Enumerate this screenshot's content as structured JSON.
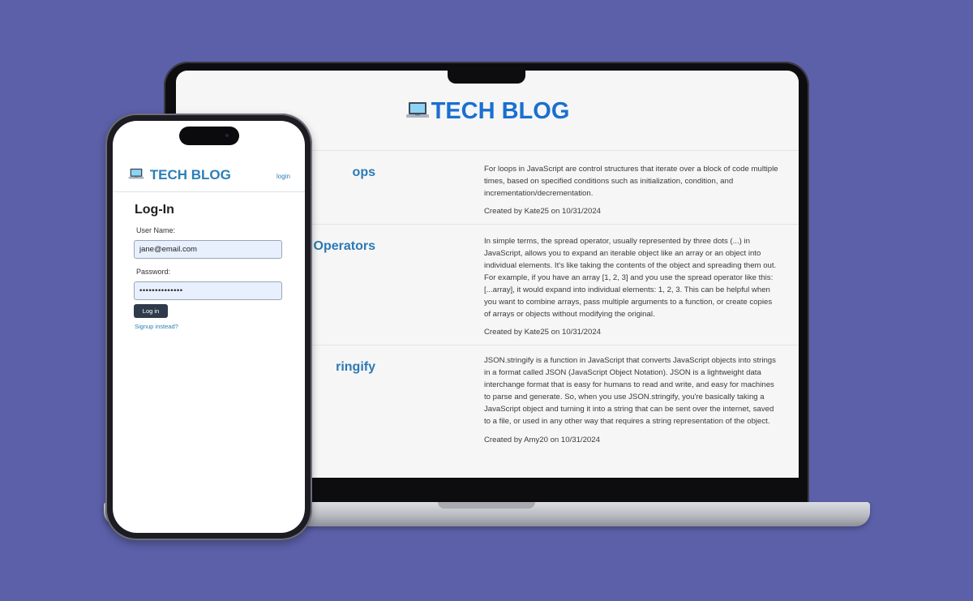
{
  "colors": {
    "background": "#5b60a9",
    "brand_blue": "#1a6fd0",
    "post_title_blue": "#2b79b4",
    "input_background": "#e8f0fe",
    "button_background": "#2f3b4c"
  },
  "brand_icon": "laptop-icon",
  "laptop_site": {
    "title": "TECH BLOG",
    "posts": [
      {
        "title": "ops",
        "body": "For loops in JavaScript are control structures that iterate over a block of code multiple times, based on specified conditions such as initialization, condition, and incrementation/decrementation.",
        "meta": "Created by Kate25 on 10/31/2024"
      },
      {
        "title": "Operators",
        "body": "In simple terms, the spread operator, usually represented by three dots (...) in JavaScript, allows you to expand an iterable object like an array or an object into individual elements. It's like taking the contents of the object and spreading them out. For example, if you have an array [1, 2, 3] and you use the spread operator like this: [...array], it would expand into individual elements: 1, 2, 3. This can be helpful when you want to combine arrays, pass multiple arguments to a function, or create copies of arrays or objects without modifying the original.",
        "meta": "Created by Kate25 on 10/31/2024"
      },
      {
        "title": "ringify",
        "body": "JSON.stringify is a function in JavaScript that converts JavaScript objects into strings in a format called JSON (JavaScript Object Notation). JSON is a lightweight data interchange format that is easy for humans to read and write, and easy for machines to parse and generate. So, when you use JSON.stringify, you're basically taking a JavaScript object and turning it into a string that can be sent over the internet, saved to a file, or used in any other way that requires a string representation of the object.",
        "meta": "Created by Amy20 on 10/31/2024"
      }
    ]
  },
  "phone_site": {
    "title": "TECH BLOG",
    "login_link": "login",
    "form": {
      "heading": "Log-In",
      "username_label": "User Name:",
      "username_value": "jane@email.com",
      "password_label": "Password:",
      "password_value": "••••••••••••••",
      "login_button": "Log in",
      "signup_link": "Signup instead?"
    }
  }
}
